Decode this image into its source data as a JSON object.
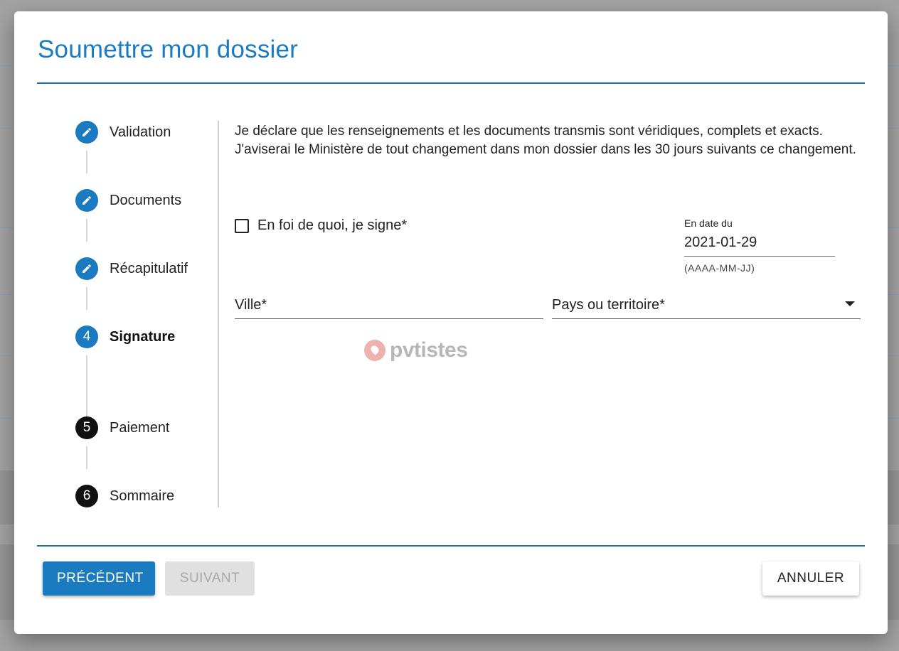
{
  "dialog": {
    "title": "Soumettre mon dossier"
  },
  "stepper": {
    "steps": [
      {
        "label": "Validation",
        "indicator": "pencil-icon",
        "status": "completed"
      },
      {
        "label": "Documents",
        "indicator": "pencil-icon",
        "status": "completed"
      },
      {
        "label": "Récapitulatif",
        "indicator": "pencil-icon",
        "status": "completed"
      },
      {
        "label": "Signature",
        "number": "4",
        "status": "active"
      },
      {
        "label": "Paiement",
        "number": "5",
        "status": "pending"
      },
      {
        "label": "Sommaire",
        "number": "6",
        "status": "pending"
      }
    ]
  },
  "content": {
    "declaration": "Je déclare que les renseignements et les documents transmis sont véridiques, complets et exacts. J'aviserai le Ministère de tout changement dans mon dossier dans les 30 jours suivants ce changement.",
    "sign_checkbox_label": "En foi de quoi, je signe*",
    "sign_checked": false,
    "date_label": "En date du",
    "date_value": "2021-01-29",
    "date_hint": "(AAAA-MM-JJ)",
    "city_placeholder": "Ville*",
    "country_placeholder": "Pays ou territoire*"
  },
  "watermark": {
    "text": "pvtistes"
  },
  "footer": {
    "previous_label": "PRÉCÉDENT",
    "next_label": "SUIVANT",
    "cancel_label": "ANNULER"
  },
  "colors": {
    "accent": "#1a7bc0",
    "step_pending": "#111111",
    "disabled_button": "#e0e0e0"
  }
}
